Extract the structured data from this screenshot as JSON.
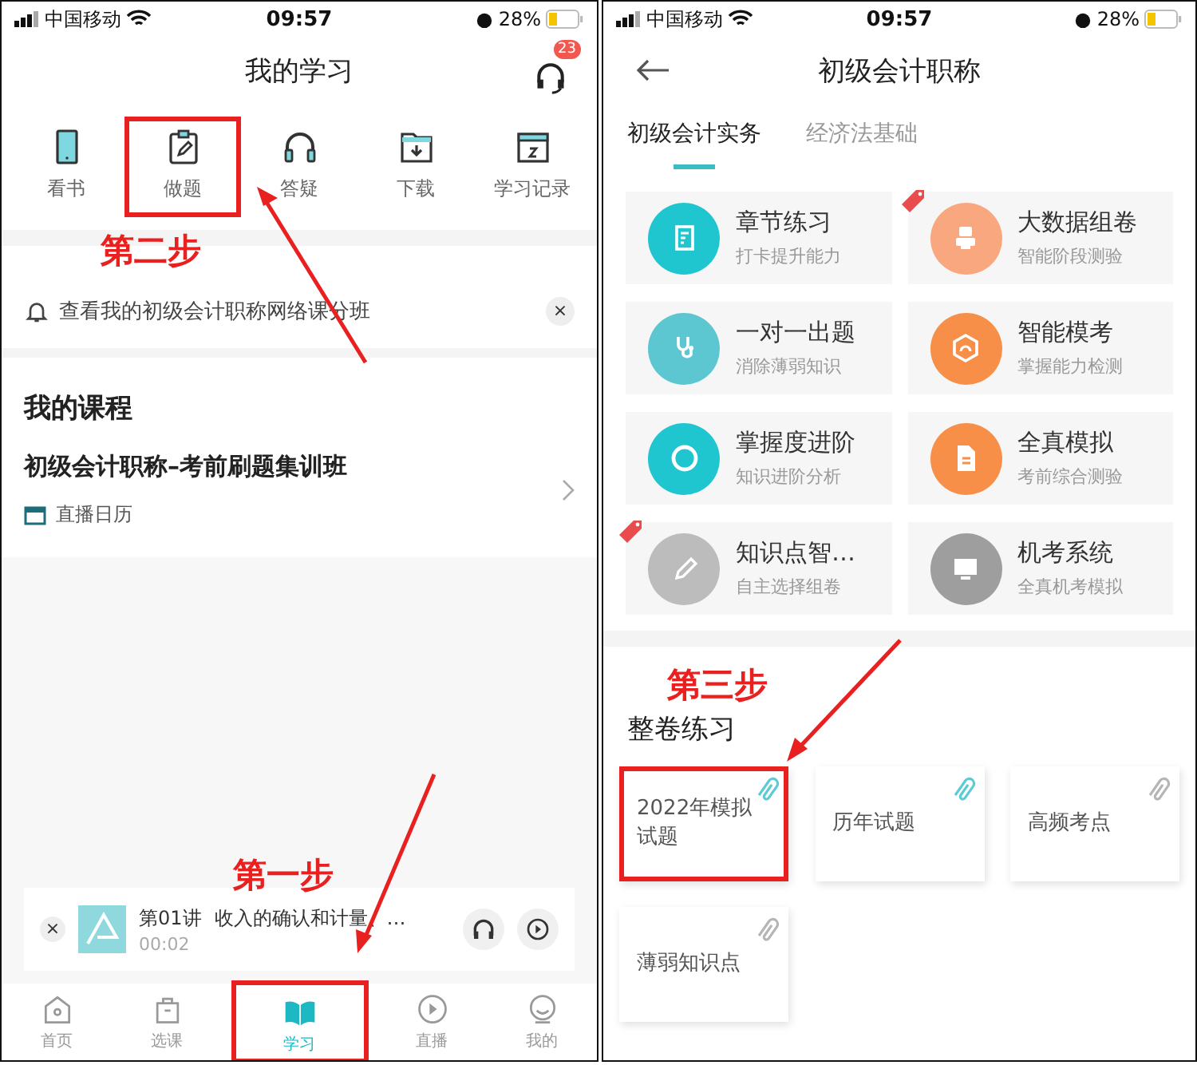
{
  "left_screen": {
    "status_bar": {
      "carrier": "中国移动",
      "time": "09:57",
      "battery": "28%"
    },
    "title": "我的学习",
    "badge": "23",
    "tools": [
      {
        "label": "看书",
        "highlighted": false
      },
      {
        "label": "做题",
        "highlighted": true
      },
      {
        "label": "答疑",
        "highlighted": false
      },
      {
        "label": "下载",
        "highlighted": false
      },
      {
        "label": "学习记录",
        "highlighted": false
      }
    ],
    "step_two": "第二步",
    "notice": {
      "text": "查看我的初级会计职称网络课分班",
      "close": "×"
    },
    "section_title": "我的课程",
    "course": {
      "title": "初级会计职称–考前刷题集训班",
      "link": "直播日历"
    },
    "step_one": "第一步",
    "player": {
      "close": "×",
      "lesson": "第01讲",
      "title": "收入的确认和计量、…",
      "time": "00:02"
    },
    "tab_bar": [
      {
        "label": "首页",
        "selected": false,
        "highlighted": false
      },
      {
        "label": "选课",
        "selected": false,
        "highlighted": false
      },
      {
        "label": "学习",
        "selected": true,
        "highlighted": true
      },
      {
        "label": "直播",
        "selected": false,
        "highlighted": false
      },
      {
        "label": "我的",
        "selected": false,
        "highlighted": false
      }
    ]
  },
  "right_screen": {
    "status_bar": {
      "carrier": "中国移动",
      "time": "09:57",
      "battery": "28%"
    },
    "title": "初级会计职称",
    "tabs": [
      {
        "label": "初级会计实务",
        "selected": true
      },
      {
        "label": "经济法基础",
        "selected": false
      }
    ],
    "features": [
      {
        "title": "章节练习",
        "subtitle": "打卡提升能力",
        "color": "#1fc6cf",
        "hot": false
      },
      {
        "title": "大数据组卷",
        "subtitle": "智能阶段测验",
        "color": "#f9a77f",
        "hot": true
      },
      {
        "title": "一对一出题",
        "subtitle": "消除薄弱知识",
        "color": "#5cc7d1",
        "hot": false
      },
      {
        "title": "智能模考",
        "subtitle": "掌握能力检测",
        "color": "#f78f48",
        "hot": false
      },
      {
        "title": "掌握度进阶",
        "subtitle": "知识进阶分析",
        "color": "#1fc6cf",
        "hot": false
      },
      {
        "title": "全真模拟",
        "subtitle": "考前综合测验",
        "color": "#f78f48",
        "hot": false
      },
      {
        "title": "知识点智…",
        "subtitle": "自主选择组卷",
        "color": "#bcbcbc",
        "hot": true
      },
      {
        "title": "机考系统",
        "subtitle": "全真机考模拟",
        "color": "#9e9e9e",
        "hot": false
      }
    ],
    "step_three": "第三步",
    "section_title": "整卷练习",
    "papers": [
      {
        "title": "2022年模拟试题",
        "color": "#5ccbd6",
        "highlighted": true
      },
      {
        "title": "历年试题",
        "color": "#5ccbd6",
        "highlighted": false
      },
      {
        "title": "高频考点",
        "color": "#b5b5b5",
        "highlighted": false
      },
      {
        "title": "薄弱知识点",
        "color": "#b5b5b5",
        "highlighted": false
      }
    ]
  }
}
